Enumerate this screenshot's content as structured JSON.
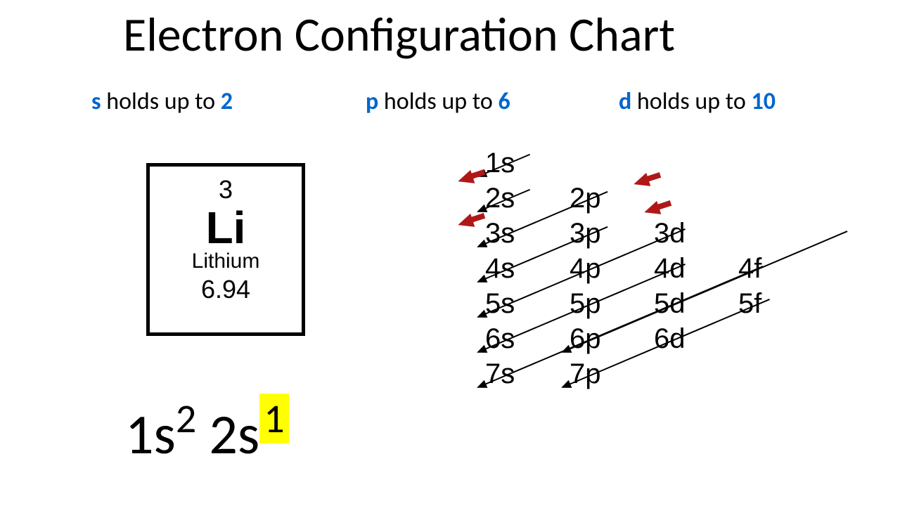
{
  "title": "Electron Configuration Chart",
  "capacities": {
    "s": {
      "orbital": "s",
      "text": " holds up to ",
      "value": "2"
    },
    "p": {
      "orbital": "p",
      "text": " holds up to ",
      "value": "6"
    },
    "d": {
      "orbital": "d",
      "text": " holds up to ",
      "value": "10"
    }
  },
  "element": {
    "atomic_number": "3",
    "symbol": "Li",
    "name": "Lithium",
    "mass": "6.94"
  },
  "configuration": {
    "term1_base": "1s",
    "term1_sup": "2",
    "term2_base": "2s",
    "term2_sup": "1"
  },
  "orbital_chart": {
    "rows": [
      [
        "1s"
      ],
      [
        "2s",
        "2p"
      ],
      [
        "3s",
        "3p",
        "3d"
      ],
      [
        "4s",
        "4p",
        "4d",
        "4f"
      ],
      [
        "5s",
        "5p",
        "5d",
        "5f"
      ],
      [
        "6s",
        "6p",
        "6d"
      ],
      [
        "7s",
        "7p"
      ]
    ]
  },
  "chart_data": {
    "type": "diagram",
    "title": "Electron Configuration Chart",
    "subshell_capacity": {
      "s": 2,
      "p": 6,
      "d": 10
    },
    "element": {
      "Z": 3,
      "symbol": "Li",
      "name": "Lithium",
      "mass": 6.94
    },
    "ground_state_configuration": [
      {
        "subshell": "1s",
        "electrons": 2
      },
      {
        "subshell": "2s",
        "electrons": 1
      }
    ],
    "aufbau_order": [
      "1s",
      "2s",
      "2p",
      "3s",
      "3p",
      "4s",
      "3d",
      "4p",
      "5s",
      "4d",
      "5p",
      "6s",
      "4f",
      "5d",
      "6p",
      "7s",
      "5f",
      "6d",
      "7p"
    ],
    "highlighted_arrows": [
      "1s",
      "2s",
      "2p"
    ]
  }
}
